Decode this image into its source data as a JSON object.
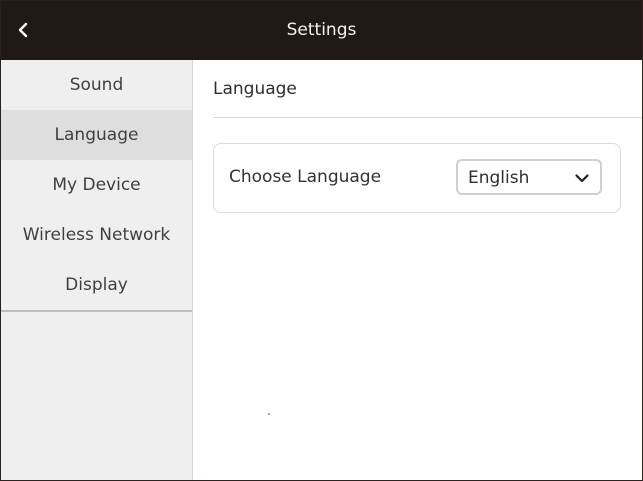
{
  "header": {
    "title": "Settings",
    "back_icon": "chevron-left-icon"
  },
  "sidebar": {
    "items": [
      {
        "label": "Sound",
        "active": false
      },
      {
        "label": "Language",
        "active": true
      },
      {
        "label": "My Device",
        "active": false
      },
      {
        "label": "Wireless Network",
        "active": false
      },
      {
        "label": "Display",
        "active": false
      }
    ]
  },
  "main": {
    "section_title": "Language",
    "setting": {
      "label": "Choose Language",
      "selected": "English",
      "dropdown_icon": "chevron-down-icon"
    }
  },
  "colors": {
    "header_bg": "#211915",
    "sidebar_bg": "#efefef",
    "sidebar_active_bg": "#dedede"
  }
}
